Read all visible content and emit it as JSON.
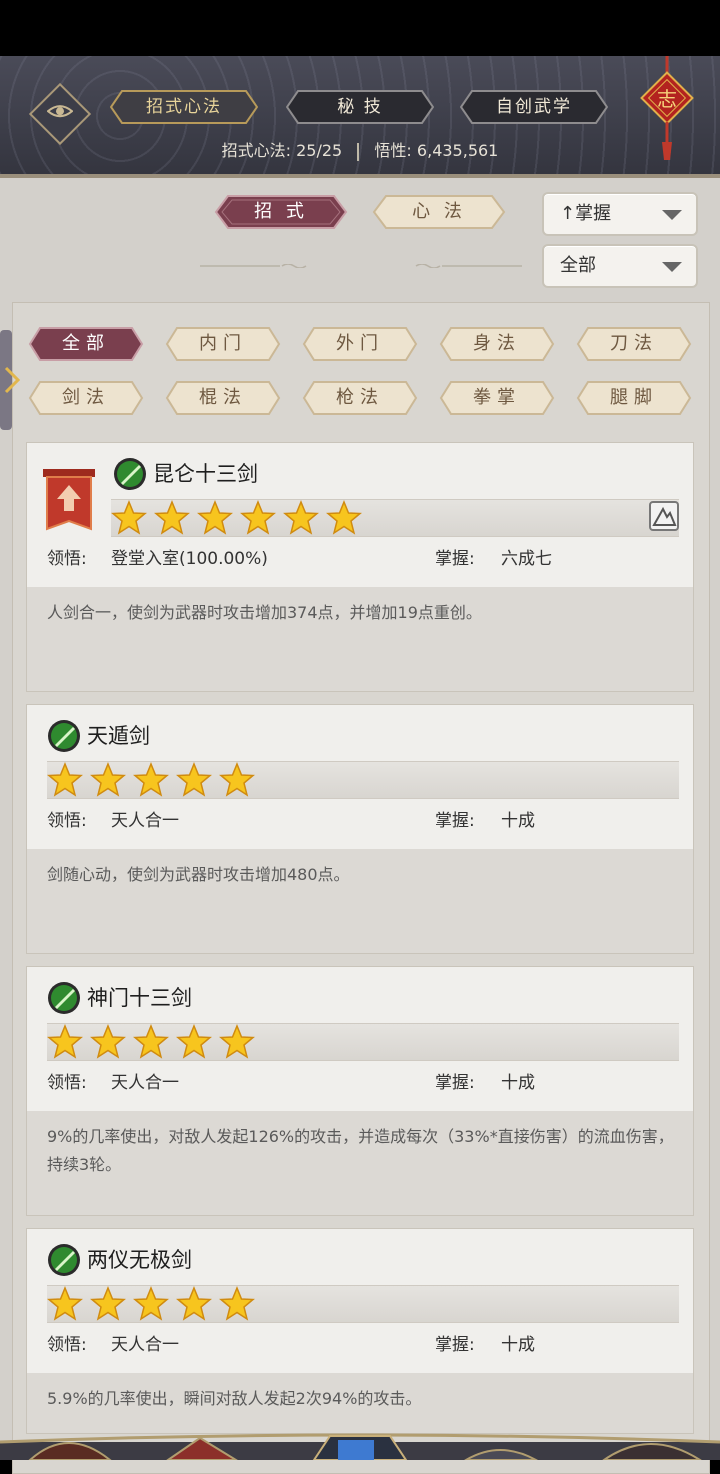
{
  "top_tabs": [
    {
      "label": "招式心法",
      "active": true
    },
    {
      "label": "秘 技",
      "active": false
    },
    {
      "label": "自创武学",
      "active": false
    }
  ],
  "stats": {
    "techniques_label": "招式心法:",
    "techniques_value": "25/25",
    "insight_label": "悟性:",
    "insight_value": "6,435,561"
  },
  "knot_char": "志",
  "segments": {
    "zhaoshi": "招 式",
    "xinfa": "心 法"
  },
  "sort_dropdown": {
    "arrow": "↑",
    "label": "掌握"
  },
  "filter_dropdown": {
    "label": "全部"
  },
  "categories": [
    {
      "label": "全部",
      "active": true
    },
    {
      "label": "内门"
    },
    {
      "label": "外门"
    },
    {
      "label": "身法"
    },
    {
      "label": "刀法"
    },
    {
      "label": "剑法"
    },
    {
      "label": "棍法"
    },
    {
      "label": "枪法"
    },
    {
      "label": "拳掌"
    },
    {
      "label": "腿脚"
    }
  ],
  "skills": [
    {
      "name": "昆仑十三剑",
      "stars": 6,
      "comprehension_label": "领悟:",
      "comprehension_value": "登堂入室(100.00%)",
      "mastery_label": "掌握:",
      "mastery_value": "六成七",
      "description": "人剑合一，使剑为武器时攻击增加374点，并增加19点重创。",
      "upgrade": true
    },
    {
      "name": "天遁剑",
      "stars": 5,
      "comprehension_label": "领悟:",
      "comprehension_value": "天人合一",
      "mastery_label": "掌握:",
      "mastery_value": "十成",
      "description": "剑随心动，使剑为武器时攻击增加480点。"
    },
    {
      "name": "神门十三剑",
      "stars": 5,
      "comprehension_label": "领悟:",
      "comprehension_value": "天人合一",
      "mastery_label": "掌握:",
      "mastery_value": "十成",
      "description": "9%的几率使出，对敌人发起126%的攻击，并造成每次（33%*直接伤害）的流血伤害，持续3轮。"
    },
    {
      "name": "两仪无极剑",
      "stars": 5,
      "comprehension_label": "领悟:",
      "comprehension_value": "天人合一",
      "mastery_label": "掌握:",
      "mastery_value": "十成",
      "description": "5.9%的几率使出，瞬间对敌人发起2次94%的攻击。"
    }
  ],
  "colors": {
    "accent_active": "#7a3f4e",
    "chip_inactive": "#ede3cf",
    "header_bg": "#3e3f4a",
    "star": "#f7c51e"
  }
}
